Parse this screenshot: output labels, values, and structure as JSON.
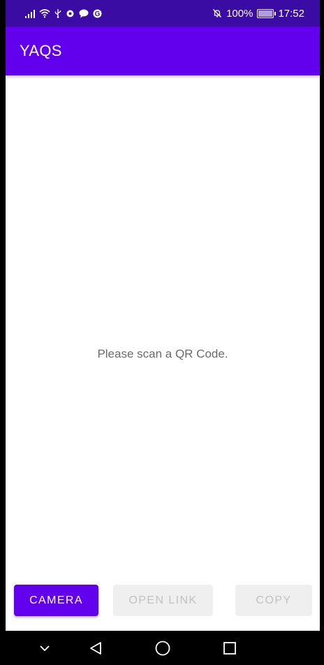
{
  "status_bar": {
    "battery_percent": "100%",
    "time": "17:52",
    "icons_left": [
      "signal-icon",
      "wifi-icon",
      "usb-icon",
      "app-notification-icon",
      "chat-icon",
      "google-icon"
    ],
    "icons_right": [
      "silent-bell-icon",
      "battery-icon"
    ]
  },
  "app_bar": {
    "title": "YAQS"
  },
  "main": {
    "message": "Please scan a QR Code."
  },
  "actions": {
    "camera_label": "CAMERA",
    "open_link_label": "OPEN LINK",
    "copy_label": "COPY"
  },
  "nav_bar": {
    "buttons": [
      "collapse-icon",
      "back-icon",
      "home-icon",
      "recents-icon"
    ]
  },
  "colors": {
    "primary": "#6200ee",
    "primary_dark": "#3a0ca3",
    "disabled_bg": "#efefef",
    "disabled_text": "#c2c2c2"
  }
}
